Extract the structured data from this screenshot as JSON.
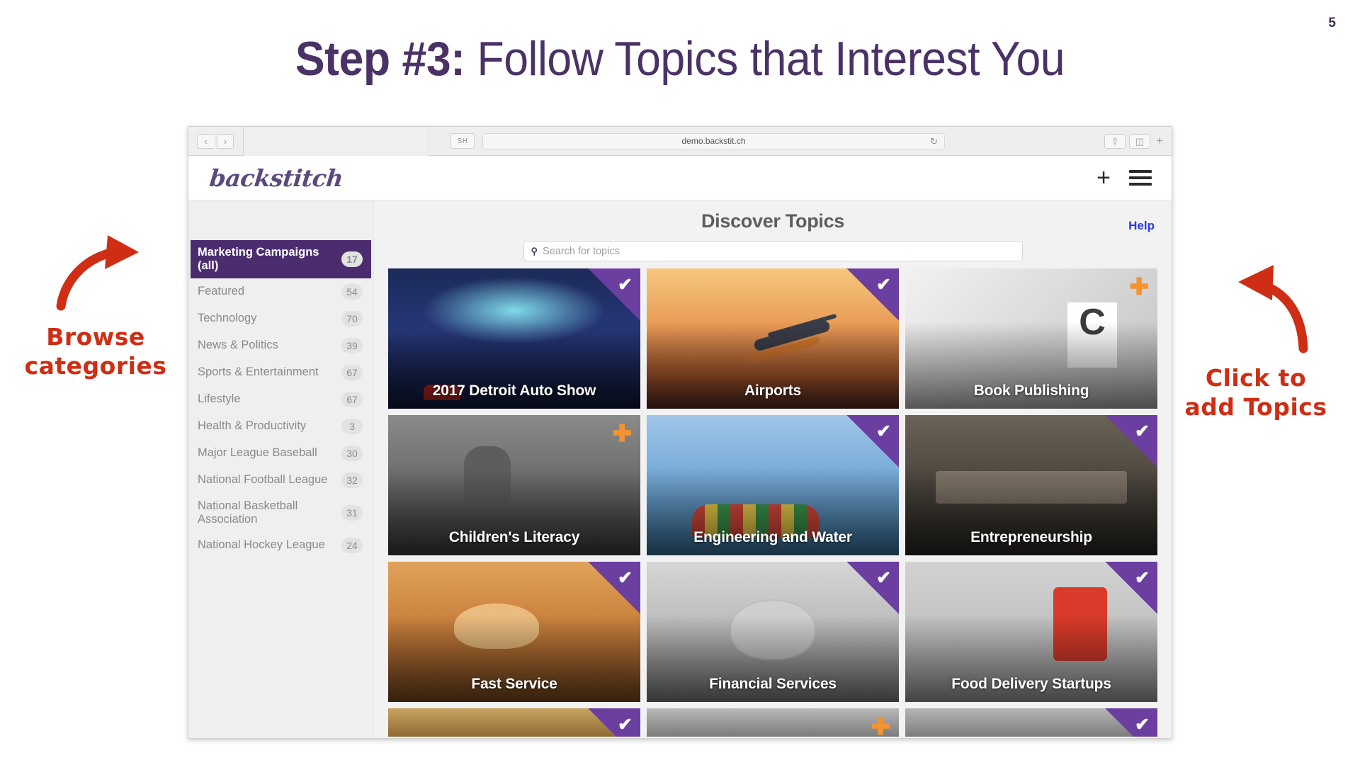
{
  "slide": {
    "number": "5",
    "title_strong": "Step #3:",
    "title_light": " Follow Topics that Interest You"
  },
  "annotations": [
    {
      "id": "browse",
      "text": "Browse\ncategories",
      "color": "#cf2e14"
    },
    {
      "id": "add",
      "text": "Click  to\nadd Topics",
      "color": "#cf2e14"
    }
  ],
  "annotation_left": "Browse categories",
  "annotation_right": "Click  to add Topics",
  "browser": {
    "back_icon": "chevron-left-icon",
    "forward_icon": "chevron-right-icon",
    "sidebar_icon": "sidebar-toggle-icon",
    "sh_badge": "SH",
    "url": "demo.backstit.ch",
    "reload_icon": "reload-icon",
    "share_icon": "share-icon",
    "tabs_icon": "tabs-icon",
    "new_tab_icon": "plus-icon"
  },
  "app": {
    "logo": "backstitch",
    "add_icon": "plus-icon",
    "menu_icon": "hamburger-menu-icon"
  },
  "main": {
    "heading": "Discover Topics",
    "help_label": "Help",
    "search_placeholder": "Search for topics",
    "search_value": "",
    "search_icon": "search-icon"
  },
  "sidebar": {
    "items": [
      {
        "label": "Marketing Campaigns (all)",
        "count": "17",
        "active": true
      },
      {
        "label": "Featured",
        "count": "54",
        "active": false
      },
      {
        "label": "Technology",
        "count": "70",
        "active": false
      },
      {
        "label": "News & Politics",
        "count": "39",
        "active": false
      },
      {
        "label": "Sports & Entertainment",
        "count": "67",
        "active": false
      },
      {
        "label": "Lifestyle",
        "count": "67",
        "active": false
      },
      {
        "label": "Health & Productivity",
        "count": "3",
        "active": false
      },
      {
        "label": "Major League Baseball",
        "count": "30",
        "active": false
      },
      {
        "label": "National Football League",
        "count": "32",
        "active": false
      },
      {
        "label": "National Basketball Association",
        "count": "31",
        "active": false
      },
      {
        "label": "National Hockey League",
        "count": "24",
        "active": false
      }
    ]
  },
  "cards": [
    {
      "title": "2017 Detroit Auto Show",
      "state": "subscribed",
      "photo": "ph-auto"
    },
    {
      "title": "Airports",
      "state": "subscribed",
      "photo": "ph-airport"
    },
    {
      "title": "Book Publishing",
      "state": "unsubscribed",
      "photo": "ph-book"
    },
    {
      "title": "Children's Literacy",
      "state": "unsubscribed",
      "photo": "ph-child"
    },
    {
      "title": "Engineering and Water",
      "state": "subscribed",
      "photo": "ph-water"
    },
    {
      "title": "Entrepreneurship",
      "state": "subscribed",
      "photo": "ph-office"
    },
    {
      "title": "Fast Service",
      "state": "subscribed",
      "photo": "ph-food"
    },
    {
      "title": "Financial Services",
      "state": "subscribed",
      "photo": "ph-fin"
    },
    {
      "title": "Food Delivery Startups",
      "state": "subscribed",
      "photo": "ph-delivery"
    },
    {
      "title": "",
      "state": "subscribed",
      "photo": "ph-r4a"
    },
    {
      "title": "",
      "state": "unsubscribed",
      "photo": "ph-r4b"
    },
    {
      "title": "",
      "state": "subscribed",
      "photo": "ph-r4c"
    }
  ],
  "colors": {
    "brand_purple": "#4b2d6f",
    "ribbon_purple": "#6b3fa0",
    "title_purple": "#4a3266",
    "accent_orange": "#f59331",
    "annotation_red": "#cf2e14",
    "help_blue": "#2b39e0"
  },
  "icons": {
    "check": "✔",
    "plus": "+",
    "search": "ὐD",
    "reload": "↻",
    "chevron_left": "‹",
    "chevron_right": "›"
  }
}
